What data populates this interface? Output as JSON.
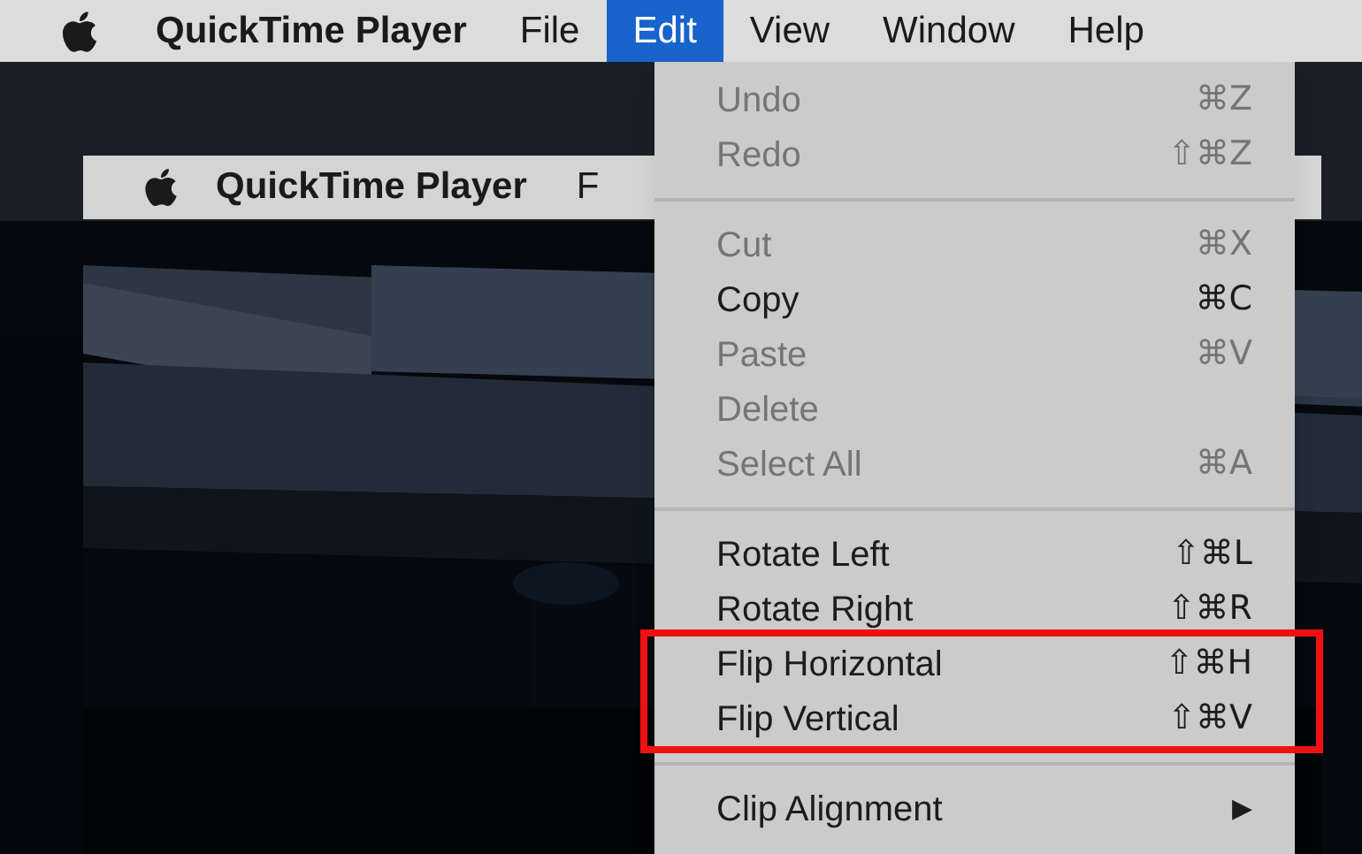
{
  "menu_bar": {
    "items": [
      {
        "label": "QuickTime Player",
        "kind": "app",
        "selected": false
      },
      {
        "label": "File",
        "kind": "menu",
        "selected": false
      },
      {
        "label": "Edit",
        "kind": "menu",
        "selected": true
      },
      {
        "label": "View",
        "kind": "menu",
        "selected": false
      },
      {
        "label": "Window",
        "kind": "menu",
        "selected": false
      },
      {
        "label": "Help",
        "kind": "menu",
        "selected": false
      }
    ]
  },
  "window": {
    "title": "QuickTime Player",
    "menu_fragment": "F"
  },
  "edit_menu": {
    "items": [
      {
        "kind": "item",
        "label": "Undo",
        "shortcut": "⌘Z",
        "disabled": true,
        "highlighted": false
      },
      {
        "kind": "item",
        "label": "Redo",
        "shortcut": "⇧⌘Z",
        "disabled": true,
        "highlighted": false
      },
      {
        "kind": "separator"
      },
      {
        "kind": "item",
        "label": "Cut",
        "shortcut": "⌘X",
        "disabled": true,
        "highlighted": false
      },
      {
        "kind": "item",
        "label": "Copy",
        "shortcut": "⌘C",
        "disabled": false,
        "highlighted": false
      },
      {
        "kind": "item",
        "label": "Paste",
        "shortcut": "⌘V",
        "disabled": true,
        "highlighted": false
      },
      {
        "kind": "item",
        "label": "Delete",
        "disabled": true,
        "highlighted": false
      },
      {
        "kind": "item",
        "label": "Select All",
        "shortcut": "⌘A",
        "disabled": true,
        "highlighted": false
      },
      {
        "kind": "separator"
      },
      {
        "kind": "item",
        "label": "Rotate Left",
        "shortcut": "⇧⌘L",
        "disabled": false,
        "highlighted": false
      },
      {
        "kind": "item",
        "label": "Rotate Right",
        "shortcut": "⇧⌘R",
        "disabled": false,
        "highlighted": false
      },
      {
        "kind": "item",
        "label": "Flip Horizontal",
        "shortcut": "⇧⌘H",
        "disabled": false,
        "highlighted": true
      },
      {
        "kind": "item",
        "label": "Flip Vertical",
        "shortcut": "⇧⌘V",
        "disabled": false,
        "highlighted": true
      },
      {
        "kind": "separator"
      },
      {
        "kind": "submenu",
        "label": "Clip Alignment",
        "arrow": "▶",
        "disabled": false,
        "highlighted": false
      }
    ]
  }
}
